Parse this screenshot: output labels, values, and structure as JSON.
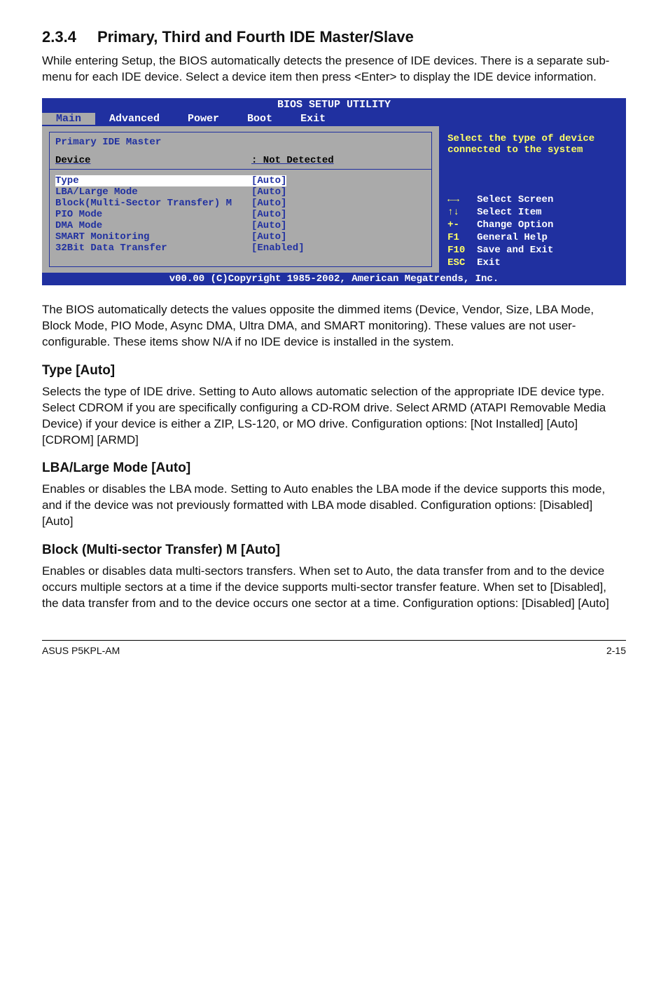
{
  "section": {
    "number": "2.3.4",
    "title": "Primary, Third and Fourth IDE Master/Slave",
    "intro": "While entering Setup, the BIOS automatically detects the presence of IDE devices. There is a separate sub-menu for each IDE device. Select a device item then press <Enter> to display the IDE device information."
  },
  "bios": {
    "title": "BIOS SETUP UTILITY",
    "menu": [
      "Main",
      "Advanced",
      "Power",
      "Boot",
      "Exit"
    ],
    "selected_menu": "Main",
    "panel_title": "Primary IDE Master",
    "device_label": "Device",
    "device_value": ": Not Detected",
    "options": [
      {
        "label": "Type",
        "value": "[Auto]",
        "highlight": true
      },
      {
        "label": "LBA/Large Mode",
        "value": "[Auto]"
      },
      {
        "label": "Block(Multi-Sector Transfer) M",
        "value": "[Auto]"
      },
      {
        "label": "PIO Mode",
        "value": "[Auto]"
      },
      {
        "label": "DMA Mode",
        "value": "[Auto]"
      },
      {
        "label": "SMART Monitoring",
        "value": "[Auto]"
      },
      {
        "label": "32Bit Data Transfer",
        "value": "[Enabled]"
      }
    ],
    "help_text": "Select the type of device connected to the system",
    "keys": [
      {
        "k": "←→",
        "v": "Select Screen"
      },
      {
        "k": "↑↓",
        "v": "Select Item"
      },
      {
        "k": "+-",
        "v": "Change Option"
      },
      {
        "k": "F1",
        "v": "General Help"
      },
      {
        "k": "F10",
        "v": "Save and Exit"
      },
      {
        "k": "ESC",
        "v": "Exit"
      }
    ],
    "footer": "v00.00 (C)Copyright 1985-2002, American Megatrends, Inc."
  },
  "after_bios": "The BIOS automatically detects the values opposite the dimmed items (Device, Vendor, Size, LBA Mode, Block Mode, PIO Mode, Async DMA, Ultra DMA, and SMART monitoring). These values are not user-configurable. These items show N/A if no IDE device is installed in the system.",
  "subsections": [
    {
      "title": "Type [Auto]",
      "body": "Selects the type of IDE drive. Setting to Auto allows automatic selection of the appropriate IDE device type. Select CDROM if you are specifically configuring a CD-ROM drive. Select ARMD (ATAPI Removable Media Device) if your device is either a ZIP, LS-120, or MO drive. Configuration options: [Not Installed] [Auto] [CDROM] [ARMD]"
    },
    {
      "title": "LBA/Large Mode [Auto]",
      "body": "Enables or disables the LBA mode. Setting to Auto enables the LBA mode if the device supports this mode, and if the device was not previously formatted with LBA mode disabled. Configuration options: [Disabled] [Auto]"
    },
    {
      "title": "Block (Multi-sector Transfer) M [Auto]",
      "body": "Enables or disables data multi-sectors transfers. When set to Auto, the data transfer from and to the device occurs multiple sectors at a time if the device supports multi-sector transfer feature. When set to [Disabled], the data transfer from and to the device occurs one sector at a time. Configuration options: [Disabled] [Auto]"
    }
  ],
  "page_footer": {
    "product": "ASUS P5KPL-AM",
    "page": "2-15"
  }
}
